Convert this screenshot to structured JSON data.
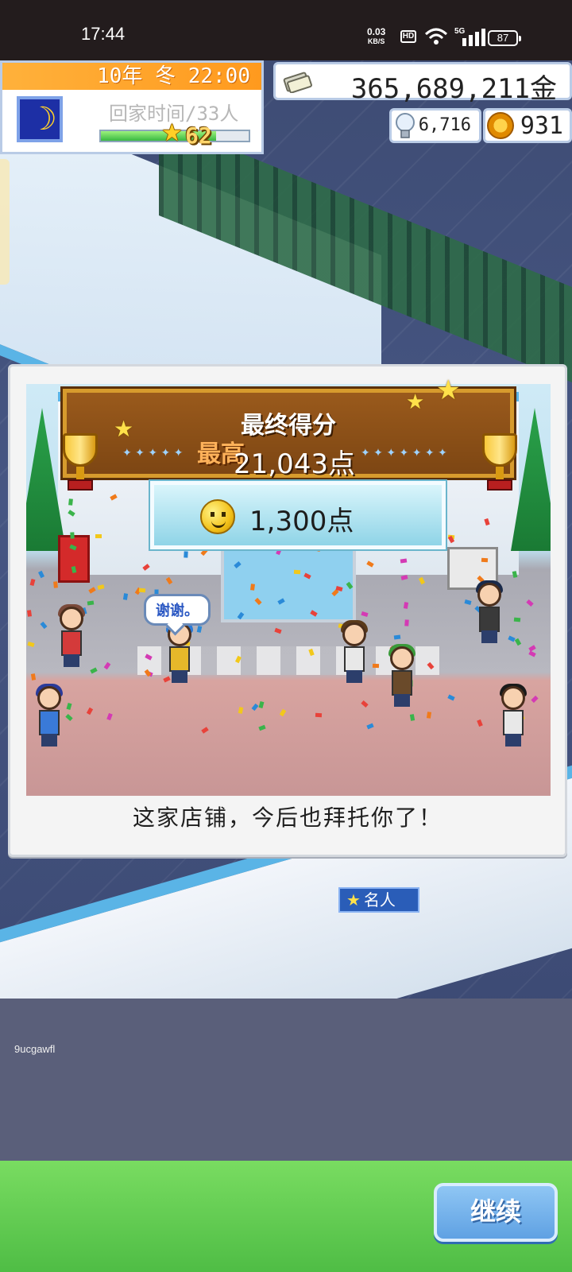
{
  "status_bar": {
    "time": "17:44",
    "net_speed_value": "0.03",
    "net_speed_unit": "KB/S",
    "hd": "HD",
    "signal_type": "5G",
    "battery": "87"
  },
  "hud": {
    "date_time": "10年 冬 22:00",
    "status_line": "回家时间/33人",
    "level": "62",
    "level_progress": 0.78,
    "money": "365,689,211金",
    "ideas": "6,716",
    "medals": "931"
  },
  "result": {
    "title": "最终得分",
    "best_tag": "最高",
    "best_score": "21,043点",
    "current_points": "1,300点",
    "speech_bubble": "谢谢。",
    "message": "这家店铺，今后也拜托你了！"
  },
  "scene": {
    "celebrity_label": "名人",
    "watermark": "9ucgawfl"
  },
  "actions": {
    "continue_label": "继续"
  },
  "colors": {
    "accent_orange": "#ff9a1e",
    "board_brown": "#7d4613",
    "button_blue": "#5fa1e3",
    "bottom_green": "#4fbd45"
  }
}
